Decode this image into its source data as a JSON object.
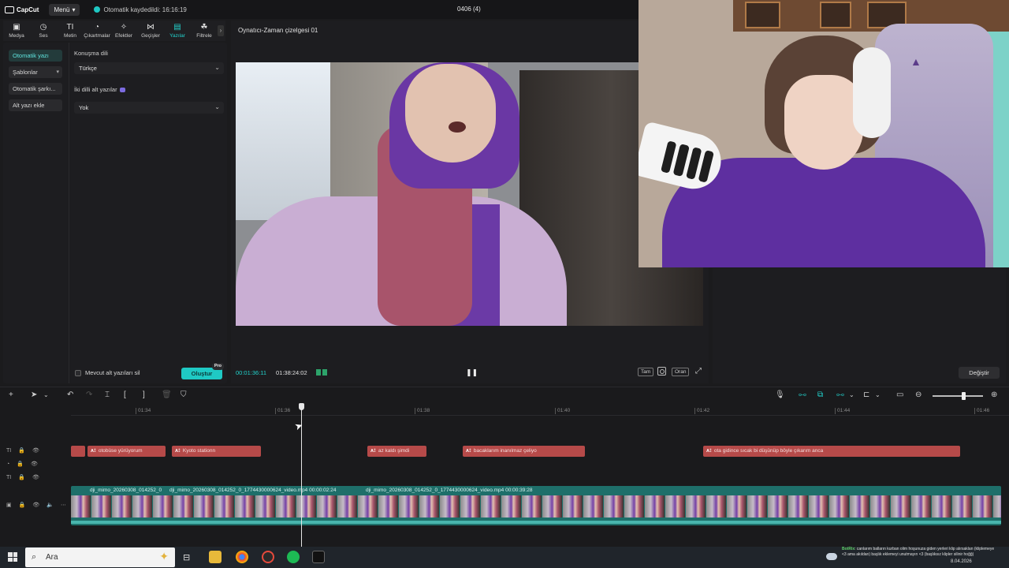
{
  "app": {
    "logo_text": "CapCut",
    "menu_label": "Menü",
    "save_status": "Otomatik kaydedildi: 16:16:19",
    "project_title": "0406 (4)"
  },
  "toolbar": {
    "items": [
      {
        "label": "Medya",
        "icon": "media-icon",
        "glyph": "▣"
      },
      {
        "label": "Ses",
        "icon": "audio-icon",
        "glyph": "◷"
      },
      {
        "label": "Metin",
        "icon": "text-icon",
        "glyph": "TI"
      },
      {
        "label": "Çıkartmalar",
        "icon": "sticker-icon",
        "glyph": "◔"
      },
      {
        "label": "Efektler",
        "icon": "effects-icon",
        "glyph": "✧"
      },
      {
        "label": "Geçişler",
        "icon": "transitions-icon",
        "glyph": "⋈"
      },
      {
        "label": "Yazılar",
        "icon": "captions-icon",
        "glyph": "▤"
      },
      {
        "label": "Filtrele",
        "icon": "filter-icon",
        "glyph": "☘"
      }
    ]
  },
  "left_panel": {
    "nav": [
      {
        "label": "Otomatik yazı",
        "active": true
      },
      {
        "label": "Şablonlar",
        "has_chevron": true
      },
      {
        "label": "Otomatik şarkı..."
      },
      {
        "label": "Alt yazı ekle"
      }
    ],
    "speech_language_label": "Konuşma dili",
    "speech_language_value": "Türkçe",
    "bilingual_label": "İki dilli alt yazılar",
    "bilingual_value": "Yok",
    "delete_existing_label": "Mevcut alt yazıları sil",
    "create_label": "Oluştur",
    "pro_badge": "Pro"
  },
  "player": {
    "title": "Oynatıcı-Zaman çizelgesi 01",
    "current_time": "00:01:36:11",
    "total_time": "01:38:24:02",
    "full_label": "Tam",
    "ratio_label": "Oran"
  },
  "right_panel": {
    "change_label": "Değiştir"
  },
  "timeline": {
    "ruler_ticks": [
      "01:34",
      "01:36",
      "01:38",
      "01:40",
      "01:42",
      "01:44",
      "01:46"
    ],
    "subtitle_clips": [
      {
        "text": "otobüse yürüyorum"
      },
      {
        "text": "Kyoto stationn"
      },
      {
        "text": "az kaldı şimdi"
      },
      {
        "text": "bacaklarım inanılmaz çeliyo"
      },
      {
        "text": "ota gidince sıcak bi düşünüp böyle çıkarım anca"
      }
    ],
    "video_labels": [
      "dji_mimo_20260308_014252_0",
      "dji_mimo_20260308_014252_0_1774430000624_video.mp4   00:00:02:24",
      "dji_mimo_20260308_014252_0_1774430000624_video.mp4   00:00:39:28"
    ]
  },
  "taskbar": {
    "search_placeholder": "Ara",
    "chat_user": "BotRix",
    "chat_message": ": canlarım balların kurban olim hoşunuza giden yerleri klip alırsaklan (kliplemeye <3 ama akıldan) başlık eklemeyi unutmayın <3 (başlıksız klipler silinir hoğğ)",
    "date": "8.04.2026"
  }
}
